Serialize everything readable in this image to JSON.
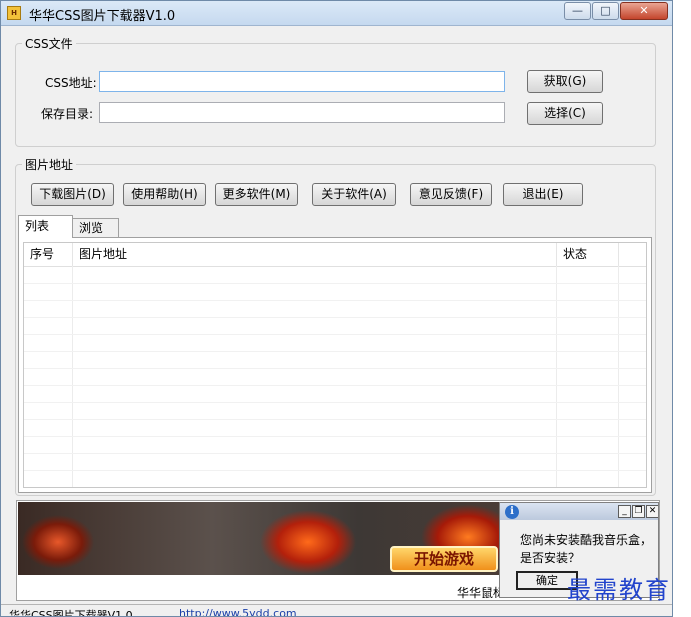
{
  "window": {
    "title": "华华CSS图片下载器V1.0",
    "icon_label": "H",
    "min_glyph": "—",
    "max_glyph": "□",
    "close_glyph": "✕"
  },
  "css_group": {
    "label": "CSS文件",
    "css_url_label": "CSS地址:",
    "css_url_value": "",
    "save_dir_label": "保存目录:",
    "save_dir_value": "",
    "fetch_button": "获取(G)",
    "choose_button": "选择(C)"
  },
  "image_group": {
    "label": "图片地址",
    "buttons": [
      "下载图片(D)",
      "使用帮助(H)",
      "更多软件(M)",
      "关于软件(A)",
      "意见反馈(F)",
      "退出(E)"
    ]
  },
  "tabs": [
    "列表",
    "浏览"
  ],
  "list": {
    "columns": [
      "序号",
      "图片地址",
      "状态"
    ]
  },
  "ad": {
    "start_game": "开始游戏",
    "caption": "华华鼠标"
  },
  "popup": {
    "line1": "您尚未安装酷我音乐盒，",
    "line2": "是否安装？",
    "ok_button": "确定"
  },
  "watermark": "最需教育",
  "statusbar": {
    "app_name": "华华CSS图片下载器V1.0",
    "url": "http://www.5ydd.com"
  },
  "colors": {
    "title_bar": "#c5d9ef",
    "close_button": "#c4452c",
    "watermark": "#2244cc"
  }
}
